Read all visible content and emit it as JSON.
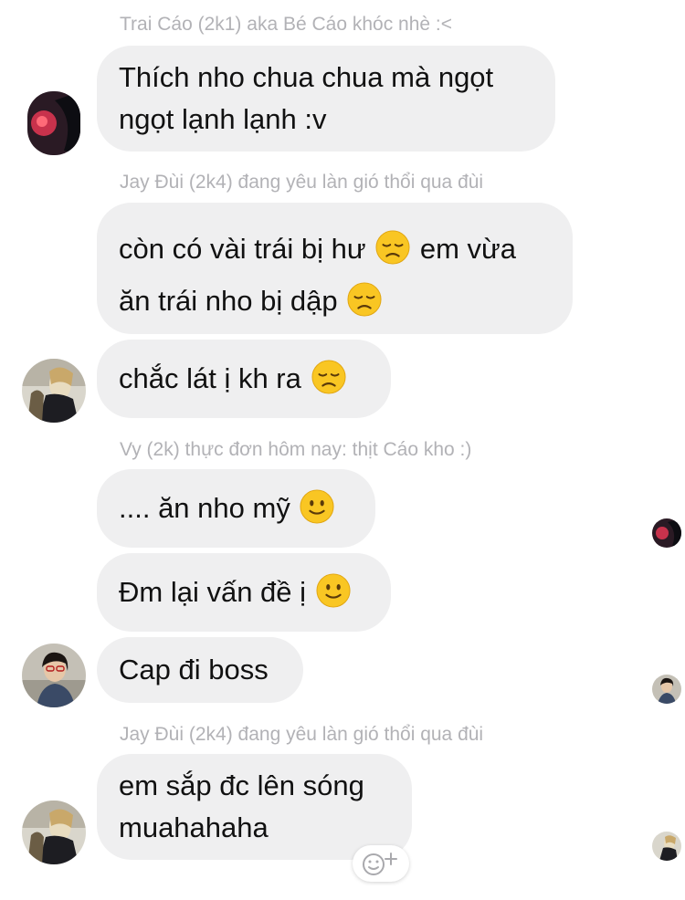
{
  "messages": [
    {
      "sender": "Trai Cáo (2k1) aka Bé Cáo khóc nhè :<",
      "lines": [
        "Thích nho chua chua mà ngọt",
        "ngọt lạnh lạnh :v"
      ]
    },
    {
      "sender": "Jay Đùi (2k4) đang yêu làn gió thổi qua đùi",
      "bubble1_line1_a": "còn có vài trái bị hư",
      "bubble1_line1_b": "em vừa",
      "bubble1_line2": "ăn trái nho bị dập",
      "bubble2": "chắc lát ị kh ra"
    },
    {
      "sender": "Vy (2k) thực đơn hôm nay: thịt Cáo kho :)",
      "bubble1": ".... ăn nho mỹ",
      "bubble2": "Đm lại vấn đề ị",
      "bubble3": "Cap đi boss"
    },
    {
      "sender": "Jay Đùi (2k4) đang yêu làn gió thổi qua đùi",
      "lines": [
        "em sắp đc lên sóng",
        "muahahaha"
      ]
    }
  ],
  "icons": {
    "sad_emoji": "disappointed-face-emoji",
    "smile_emoji": "slightly-smiling-face-emoji",
    "react": "add-reaction-icon"
  },
  "colors": {
    "bubble_bg": "#efeff0",
    "sender_text": "#b2b2b6",
    "message_text": "#111111"
  }
}
